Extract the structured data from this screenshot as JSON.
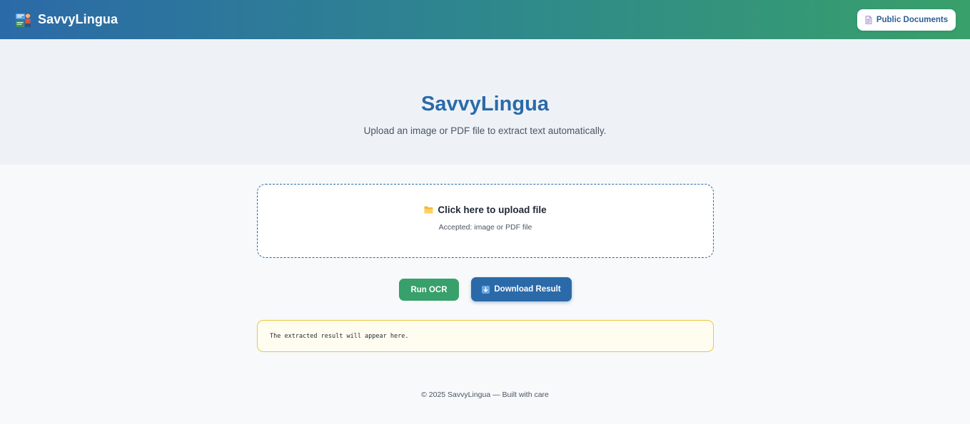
{
  "header": {
    "brand_name": "SavvyLingua",
    "brand_logo_icon": "reading-person-icon",
    "docs_button_label": "Public Documents",
    "docs_button_icon": "document-icon"
  },
  "hero": {
    "title": "SavvyLingua",
    "subtitle": "Upload an image or PDF file to extract text automatically."
  },
  "upload": {
    "icon": "folder-icon",
    "title": "Click here to upload file",
    "note": "Accepted: image or PDF file"
  },
  "actions": {
    "run_label": "Run OCR",
    "download_label": "Download Result",
    "download_icon": "download-arrow-icon"
  },
  "result": {
    "placeholder": "The extracted result will appear here."
  },
  "footer": {
    "text": "© 2025 SavvyLingua — Built with care"
  },
  "colors": {
    "brand_blue": "#2b6aa8",
    "brand_green": "#38a06a",
    "hero_bg": "#eef2f7",
    "result_border": "#f0c73c"
  }
}
